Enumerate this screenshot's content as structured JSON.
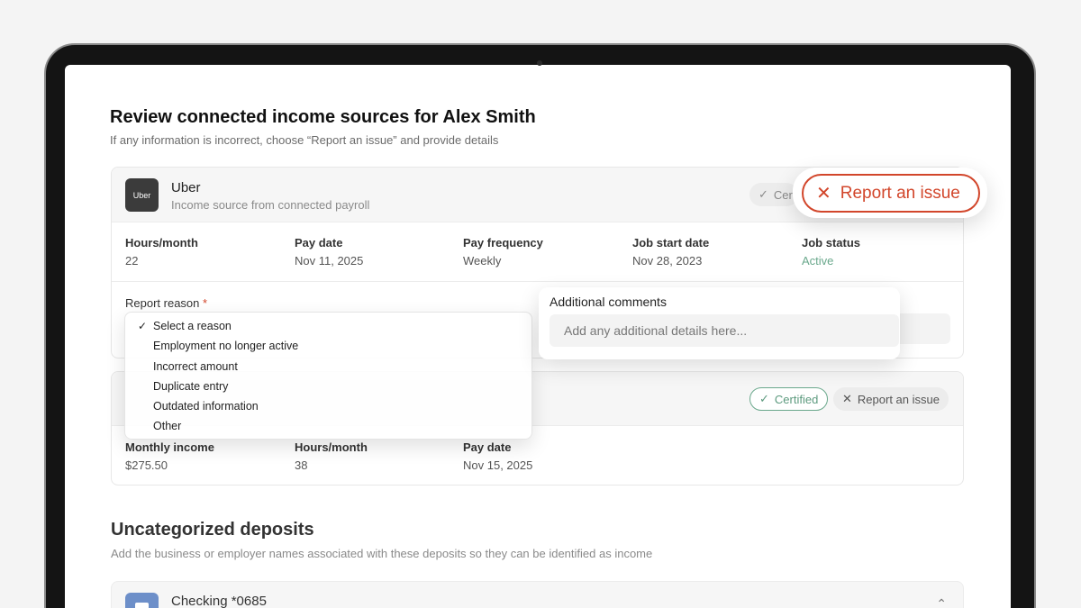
{
  "header": {
    "title": "Review connected income sources for Alex Smith",
    "subtitle": "If any information is incorrect, choose “Report an issue” and provide details"
  },
  "source1": {
    "logo_text": "Uber",
    "name": "Uber",
    "subtitle": "Income source from connected payroll",
    "certified_partial": "Cer",
    "fields": [
      {
        "label": "Hours/month",
        "value": "22"
      },
      {
        "label": "Pay date",
        "value": "Nov 11, 2025"
      },
      {
        "label": "Pay frequency",
        "value": "Weekly"
      },
      {
        "label": "Job start date",
        "value": "Nov 28, 2023"
      },
      {
        "label": "Job status",
        "value": "Active"
      }
    ],
    "report_reason_label": "Report reason",
    "required_mark": "*"
  },
  "report_button": {
    "label": "Report an issue"
  },
  "dropdown": {
    "options": [
      {
        "label": "Select a reason",
        "selected": true,
        "check": "✓"
      },
      {
        "label": "Employment no longer active"
      },
      {
        "label": "Incorrect amount"
      },
      {
        "label": "Duplicate entry"
      },
      {
        "label": "Outdated information"
      },
      {
        "label": "Other"
      }
    ]
  },
  "comments": {
    "label": "Additional comments",
    "placeholder": "Add any additional details here..."
  },
  "source2": {
    "certified_label": "Certified",
    "report_label": "Report an issue",
    "fields": [
      {
        "label": "Monthly income",
        "value": "$275.50"
      },
      {
        "label": "Hours/month",
        "value": "38"
      },
      {
        "label": "Pay date",
        "value": "Nov 15, 2025"
      }
    ]
  },
  "deposits": {
    "title": "Uncategorized deposits",
    "subtitle": "Add the business or employer names associated with these deposits so they can be identified as income",
    "account_name": "Checking *0685"
  },
  "colors": {
    "accent_red": "#d2462b",
    "success_green": "#6aa88c",
    "bank_blue": "#6d8fc9"
  },
  "icons": {
    "check": "check-icon",
    "close": "close-icon",
    "chevron": "chevron-up-icon",
    "bank": "bank-icon"
  }
}
